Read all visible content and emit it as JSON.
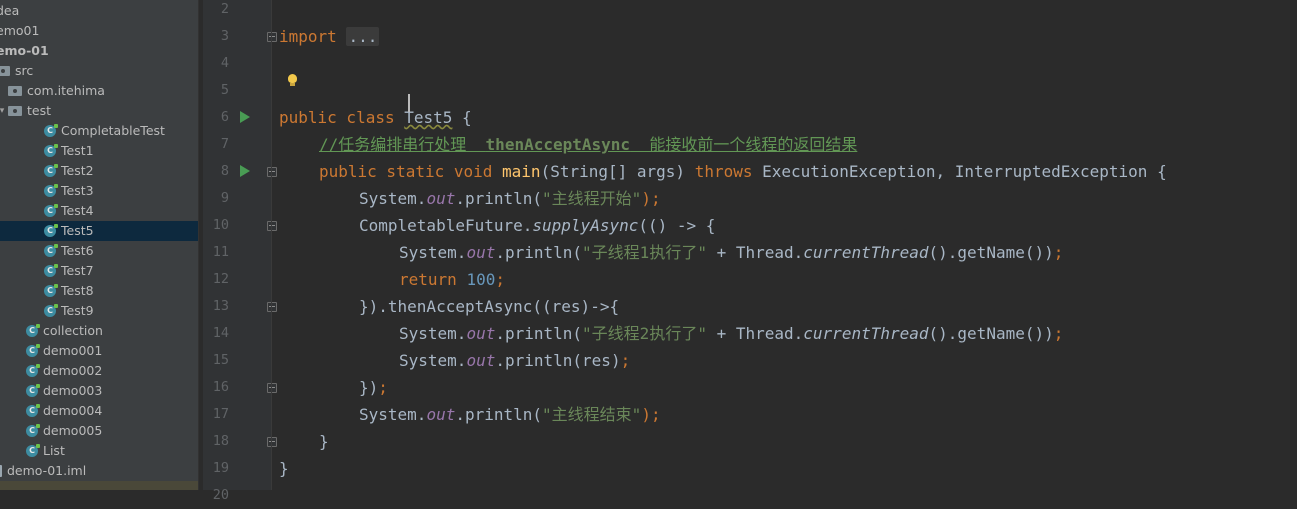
{
  "project_tree": {
    "items": [
      {
        "label": "dea",
        "type": "folder",
        "level": 0,
        "arrow": "",
        "bold": false,
        "selected": false
      },
      {
        "label": "emo01",
        "type": "folder",
        "level": 0,
        "arrow": "",
        "bold": false,
        "selected": false
      },
      {
        "label": "emo-01",
        "type": "module",
        "level": 0,
        "arrow": "",
        "bold": true,
        "selected": false
      },
      {
        "label": "src",
        "type": "folder",
        "level": 0,
        "arrow": "▾",
        "bold": false,
        "selected": false
      },
      {
        "label": "com.itehima",
        "type": "folder",
        "level": 1,
        "arrow": "",
        "bold": false,
        "selected": false
      },
      {
        "label": "test",
        "type": "folder",
        "level": 1,
        "arrow": "▾",
        "bold": false,
        "selected": false
      },
      {
        "label": "CompletableTest",
        "type": "class",
        "level": 3,
        "arrow": "",
        "bold": false,
        "selected": false
      },
      {
        "label": "Test1",
        "type": "class",
        "level": 3,
        "arrow": "",
        "bold": false,
        "selected": false
      },
      {
        "label": "Test2",
        "type": "class",
        "level": 3,
        "arrow": "",
        "bold": false,
        "selected": false
      },
      {
        "label": "Test3",
        "type": "class",
        "level": 3,
        "arrow": "",
        "bold": false,
        "selected": false
      },
      {
        "label": "Test4",
        "type": "class",
        "level": 3,
        "arrow": "",
        "bold": false,
        "selected": false
      },
      {
        "label": "Test5",
        "type": "class",
        "level": 3,
        "arrow": "",
        "bold": false,
        "selected": true
      },
      {
        "label": "Test6",
        "type": "class",
        "level": 3,
        "arrow": "",
        "bold": false,
        "selected": false
      },
      {
        "label": "Test7",
        "type": "class",
        "level": 3,
        "arrow": "",
        "bold": false,
        "selected": false
      },
      {
        "label": "Test8",
        "type": "class",
        "level": 3,
        "arrow": "",
        "bold": false,
        "selected": false
      },
      {
        "label": "Test9",
        "type": "class",
        "level": 3,
        "arrow": "",
        "bold": false,
        "selected": false
      },
      {
        "label": "collection",
        "type": "class",
        "level": 2,
        "arrow": "",
        "bold": false,
        "selected": false
      },
      {
        "label": "demo001",
        "type": "class",
        "level": 2,
        "arrow": "",
        "bold": false,
        "selected": false
      },
      {
        "label": "demo002",
        "type": "class",
        "level": 2,
        "arrow": "",
        "bold": false,
        "selected": false
      },
      {
        "label": "demo003",
        "type": "class",
        "level": 2,
        "arrow": "",
        "bold": false,
        "selected": false
      },
      {
        "label": "demo004",
        "type": "class",
        "level": 2,
        "arrow": "",
        "bold": false,
        "selected": false
      },
      {
        "label": "demo005",
        "type": "class",
        "level": 2,
        "arrow": "",
        "bold": false,
        "selected": false
      },
      {
        "label": "List",
        "type": "class",
        "level": 2,
        "arrow": "",
        "bold": false,
        "selected": false
      },
      {
        "label": "demo-01.iml",
        "type": "iml",
        "level": 0,
        "arrow": "",
        "bold": false,
        "selected": false
      }
    ]
  },
  "editor": {
    "line_numbers": [
      "2",
      "3",
      "4",
      "5",
      "6",
      "7",
      "8",
      "9",
      "10",
      "11",
      "12",
      "13",
      "14",
      "15",
      "16",
      "17",
      "18",
      "19",
      "20"
    ],
    "run_markers_on_lines": [
      "6",
      "8"
    ],
    "fold_markers_on_lines": [
      "3",
      "8",
      "10",
      "13",
      "16",
      "18"
    ],
    "lines": [
      {
        "n": "3",
        "indent": 0,
        "tokens": [
          {
            "t": "import ",
            "c": "kw"
          },
          {
            "t": "...",
            "c": "fold-box"
          }
        ]
      },
      {
        "n": "6",
        "indent": 0,
        "tokens": [
          {
            "t": "public class ",
            "c": "kw"
          },
          {
            "t": "Test5",
            "c": "cls-name"
          },
          {
            "t": " {",
            "c": ""
          }
        ]
      },
      {
        "n": "7",
        "indent": 1,
        "tokens": [
          {
            "t": "//任务编排串行处理  ",
            "c": "cmt"
          },
          {
            "t": "thenAcceptAsync",
            "c": "cmt cmt-hl"
          },
          {
            "t": "  能接收前一个线程的返回结果",
            "c": "cmt"
          }
        ]
      },
      {
        "n": "8",
        "indent": 1,
        "tokens": [
          {
            "t": "public static void ",
            "c": "kw"
          },
          {
            "t": "main",
            "c": "fn"
          },
          {
            "t": "(String[] args) ",
            "c": ""
          },
          {
            "t": "throws ",
            "c": "kw"
          },
          {
            "t": "ExecutionException, InterruptedException {",
            "c": ""
          }
        ]
      },
      {
        "n": "9",
        "indent": 2,
        "tokens": [
          {
            "t": "System.",
            "c": ""
          },
          {
            "t": "out",
            "c": "fld"
          },
          {
            "t": ".println(",
            "c": ""
          },
          {
            "t": "\"主线程开始\"",
            "c": "str"
          },
          {
            "t": ");",
            "c": "kw"
          }
        ]
      },
      {
        "n": "10",
        "indent": 2,
        "tokens": [
          {
            "t": "CompletableFuture.",
            "c": ""
          },
          {
            "t": "supplyAsync",
            "c": "it"
          },
          {
            "t": "(() -> {",
            "c": ""
          }
        ]
      },
      {
        "n": "11",
        "indent": 3,
        "tokens": [
          {
            "t": "System.",
            "c": ""
          },
          {
            "t": "out",
            "c": "fld"
          },
          {
            "t": ".println(",
            "c": ""
          },
          {
            "t": "\"子线程1执行了\"",
            "c": "str"
          },
          {
            "t": " + Thread.",
            "c": ""
          },
          {
            "t": "currentThread",
            "c": "it"
          },
          {
            "t": "().getName())",
            "c": ""
          },
          {
            "t": ";",
            "c": "kw"
          }
        ]
      },
      {
        "n": "12",
        "indent": 3,
        "tokens": [
          {
            "t": "return ",
            "c": "kw"
          },
          {
            "t": "100",
            "c": "num"
          },
          {
            "t": ";",
            "c": "kw"
          }
        ]
      },
      {
        "n": "13",
        "indent": 2,
        "tokens": [
          {
            "t": "}).thenAcceptAsync((res)->{",
            "c": ""
          }
        ]
      },
      {
        "n": "14",
        "indent": 3,
        "tokens": [
          {
            "t": "System.",
            "c": ""
          },
          {
            "t": "out",
            "c": "fld"
          },
          {
            "t": ".println(",
            "c": ""
          },
          {
            "t": "\"子线程2执行了\"",
            "c": "str"
          },
          {
            "t": " + Thread.",
            "c": ""
          },
          {
            "t": "currentThread",
            "c": "it"
          },
          {
            "t": "().getName())",
            "c": ""
          },
          {
            "t": ";",
            "c": "kw"
          }
        ]
      },
      {
        "n": "15",
        "indent": 3,
        "tokens": [
          {
            "t": "System.",
            "c": ""
          },
          {
            "t": "out",
            "c": "fld"
          },
          {
            "t": ".println(res)",
            "c": ""
          },
          {
            "t": ";",
            "c": "kw"
          }
        ]
      },
      {
        "n": "16",
        "indent": 2,
        "tokens": [
          {
            "t": "})",
            "c": ""
          },
          {
            "t": ";",
            "c": "kw"
          }
        ]
      },
      {
        "n": "17",
        "indent": 2,
        "tokens": [
          {
            "t": "System.",
            "c": ""
          },
          {
            "t": "out",
            "c": "fld"
          },
          {
            "t": ".println(",
            "c": ""
          },
          {
            "t": "\"主线程结束\"",
            "c": "str"
          },
          {
            "t": ");",
            "c": "kw"
          }
        ]
      },
      {
        "n": "18",
        "indent": 1,
        "tokens": [
          {
            "t": "}",
            "c": ""
          }
        ]
      },
      {
        "n": "19",
        "indent": 0,
        "tokens": [
          {
            "t": "}",
            "c": ""
          }
        ]
      }
    ]
  },
  "colors": {
    "tree_background": "#3c3f41",
    "editor_background": "#2b2b2b",
    "gutter_background": "#313335",
    "selection": "#0d293e",
    "keyword": "#cc7832",
    "string": "#6a8759",
    "comment": "#629755",
    "number": "#6897bb",
    "method": "#ffc66d",
    "field": "#9876aa"
  }
}
